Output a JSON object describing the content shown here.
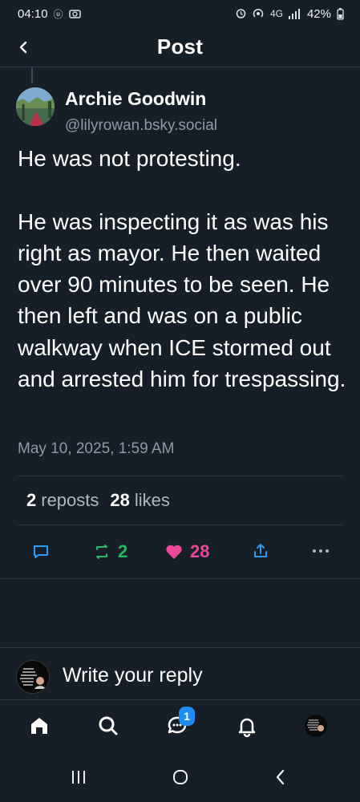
{
  "status_bar": {
    "time": "04:10",
    "left_icons": [
      "carrier-icon",
      "screenshot-icon"
    ],
    "right_icons": [
      "alarm-icon",
      "hotspot-icon",
      "4g-icon",
      "signal-icon"
    ],
    "network_label": "4G",
    "battery": "42%"
  },
  "header": {
    "title": "Post",
    "back_icon": "chevron-left-icon"
  },
  "post": {
    "author_name": "Archie Goodwin",
    "author_handle": "@lilyrowan.bsky.social",
    "body": "He was not protesting.\n\nHe was inspecting it as was his right as mayor.  He then waited over 90 minutes to be seen.  He then left and was on a public walkway when ICE stormed out and arrested him for trespassing.",
    "timestamp": "May 10, 2025, 1:59 AM",
    "reposts_count": "2",
    "reposts_label": "reposts",
    "likes_count": "28",
    "likes_label": "likes"
  },
  "actions": {
    "reply_icon": "comment-icon",
    "repost_icon": "repost-icon",
    "repost_count": "2",
    "like_icon": "heart-icon",
    "like_count": "28",
    "share_icon": "share-icon",
    "more_icon": "more-icon"
  },
  "reply": {
    "placeholder": "Write your reply"
  },
  "bottom_nav": {
    "items": [
      "home-icon",
      "search-icon",
      "chat-icon",
      "bell-icon",
      "profile-avatar"
    ],
    "chat_badge": "1"
  },
  "colors": {
    "background": "#161e27",
    "divider": "#2a3644",
    "muted_text": "#8e9aa8",
    "repost_accent": "#20bc62",
    "like_accent": "#ec4899",
    "badge": "#1d8cf5"
  }
}
